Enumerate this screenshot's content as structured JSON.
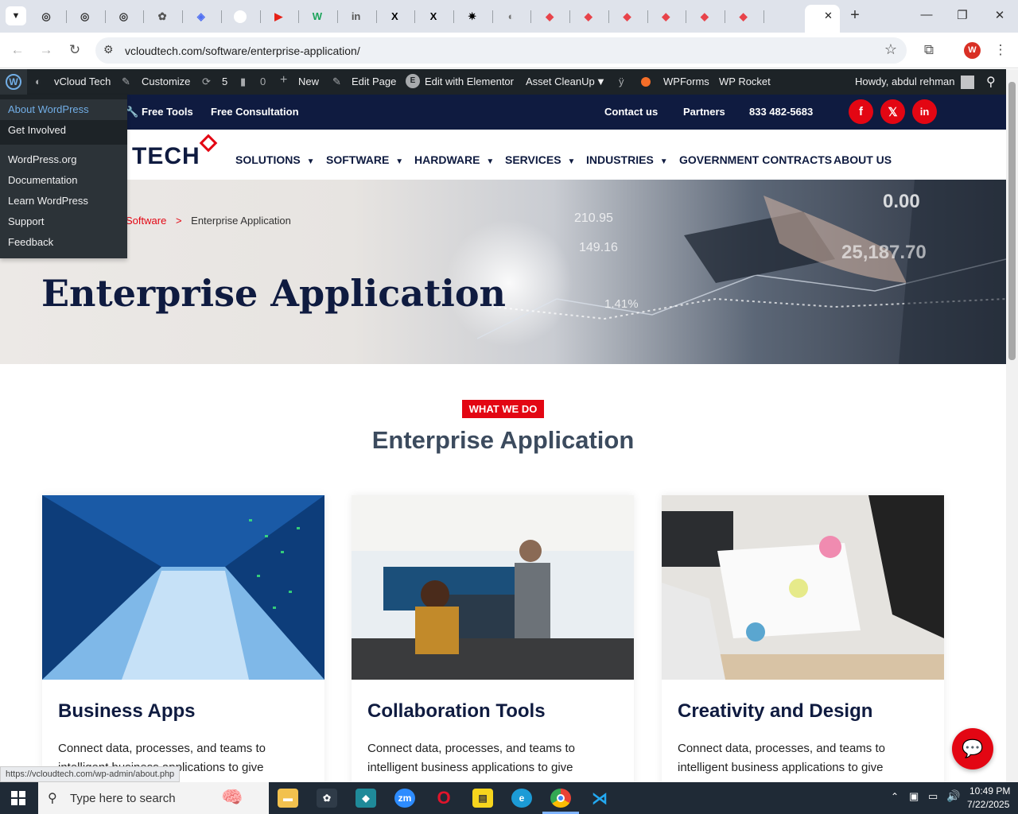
{
  "browser": {
    "url": "vcloudtech.com/software/enterprise-application/",
    "tabs": [
      "tab-1",
      "tab-2",
      "tab-3",
      "tab-4",
      "tab-5",
      "tab-6",
      "tab-7",
      "tab-8",
      "tab-9",
      "tab-10",
      "tab-11",
      "tab-12",
      "tab-13",
      "tab-14",
      "tab-15",
      "tab-16",
      "tab-17",
      "tab-18",
      "tab-19",
      "tab-20"
    ],
    "profile_initial": "W"
  },
  "wpbar": {
    "site": "vCloud Tech",
    "customize": "Customize",
    "updates": "5",
    "comments": "0",
    "new": "New",
    "edit_page": "Edit Page",
    "elementor": "Edit with Elementor",
    "asset_cleanup": "Asset CleanUp",
    "wpforms": "WPForms",
    "wprocket": "WP Rocket",
    "howdy": "Howdy, abdul rehman"
  },
  "wpmenu": {
    "group1": [
      "About WordPress",
      "Get Involved"
    ],
    "group2": [
      "WordPress.org",
      "Documentation",
      "Learn WordPress",
      "Support",
      "Feedback"
    ]
  },
  "topbar": {
    "free_tools": "Free Tools",
    "free_consultation": "Free Consultation",
    "contact": "Contact us",
    "partners": "Partners",
    "phone": "833 482-5683",
    "social": [
      "f",
      "𝕏",
      "in"
    ]
  },
  "nav": {
    "logo": "TECH",
    "items": [
      "SOLUTIONS",
      "SOFTWARE",
      "HARDWARE",
      "SERVICES",
      "INDUSTRIES",
      "GOVERNMENT CONTRACTS",
      "ABOUT US"
    ]
  },
  "hero": {
    "breadcrumb_link": "Software",
    "breadcrumb_sep": ">",
    "breadcrumb_current": "Enterprise Application",
    "title": "Enterprise Application",
    "overlay_numbers": [
      "0.00",
      "210.95",
      "149.16",
      "25,187.70",
      "1.41%"
    ]
  },
  "section": {
    "eyebrow": "WHAT WE DO",
    "title": "Enterprise Application"
  },
  "cards": [
    {
      "title": "Business Apps",
      "text": "Connect data, processes, and teams to intelligent business applications to give"
    },
    {
      "title": "Collaboration Tools",
      "text": "Connect data, processes, and teams to intelligent business applications to give"
    },
    {
      "title": "Creativity and Design",
      "text": "Connect data, processes, and teams to intelligent business applications to give"
    }
  ],
  "status_url": "https://vcloudtech.com/wp-admin/about.php",
  "taskbar": {
    "search_placeholder": "Type here to search",
    "time": "10:49 PM",
    "date": "7/22/2025"
  },
  "colors": {
    "brand_red": "#e30613",
    "navy": "#0f1b40"
  }
}
